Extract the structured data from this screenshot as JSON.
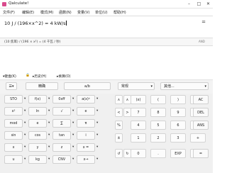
{
  "window": {
    "title": "Qalculate!",
    "minimize": "–",
    "maximize": "□",
    "close": "✕"
  },
  "menu": [
    "文件(F)",
    "编辑(E)",
    "模式(M)",
    "函数(N)",
    "变量(V)",
    "单位(U)",
    "帮助(H)"
  ],
  "expression": {
    "text": "10 J / (196×x^2) = 4 kW/s",
    "equals_button": "="
  },
  "result": {
    "text": "(10 焦耳) / (196 × x²) = (4 千瓦 / 秒)",
    "side": "AND"
  },
  "toolbar": {
    "keypad": "键盘(K)",
    "history": "历史(H)",
    "conversion": "换算(O)"
  },
  "keypad_top": {
    "exact": "精确",
    "fraction": "a/b",
    "mode": "常规",
    "more": "其他..."
  },
  "left_keys": [
    [
      "STO",
      "f(x)",
      "0xff",
      "a(x)ᵇ"
    ],
    [
      "x²",
      "ln",
      "√",
      "e"
    ],
    [
      "mod",
      "e",
      "∑",
      "π"
    ],
    [
      "sin",
      "cos",
      "tan",
      "i"
    ],
    [
      "x",
      "y",
      "z",
      "x ="
    ],
    [
      "u",
      "kg",
      "CNV",
      "x→"
    ]
  ],
  "right_keys": [
    [
      "(x)",
      "(",
      ")",
      "xʸ",
      "AC"
    ],
    [
      "7",
      "8",
      "9",
      "×",
      "DEL"
    ],
    [
      "4",
      "5",
      "6",
      "÷",
      "ANS"
    ],
    [
      "1",
      "2",
      "3",
      "+",
      ""
    ],
    [
      "0",
      ".",
      "EXP",
      "−",
      "="
    ]
  ],
  "nav_keys": [
    "∧",
    "∧",
    "<",
    ">",
    "%",
    "±",
    "↺",
    "↻"
  ],
  "arrow_label": "▾"
}
